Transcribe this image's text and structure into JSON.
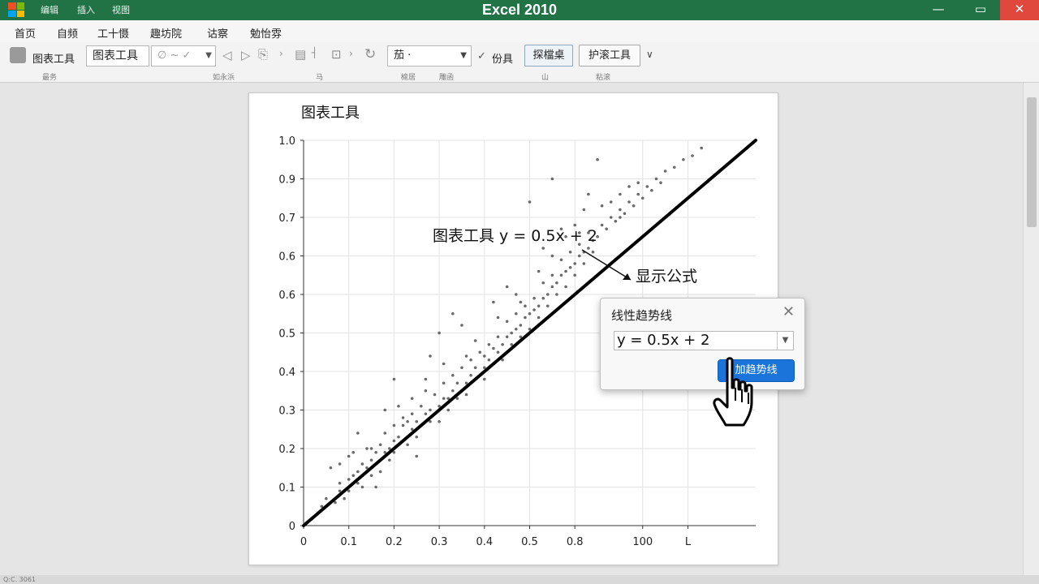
{
  "window": {
    "title": "Excel 2010",
    "minimize": "—",
    "maximize": "▭",
    "close": "✕"
  },
  "colors": {
    "titlebar": "#217346",
    "accent_button": "#1b74d9",
    "trendline": "#000000",
    "points": "#6a6a6a"
  },
  "quick_access": [
    "编辑",
    "插入",
    "视图"
  ],
  "menu": [
    "首页",
    "自频",
    "工十慑",
    "趣坊院",
    "诂察",
    "勉怡雰"
  ],
  "ribbon": {
    "chart_tools_label": "图表工具",
    "chart_tools_box": "图表工具",
    "style_box": "∅ ~ ✓",
    "font_box": "茄 ·",
    "check": "✓",
    "lbl_format": "份具",
    "btn_layout": "探檔桌",
    "btn_protect": "护滚工具",
    "group_labels": [
      "最务",
      "如永浜",
      "马",
      "榆居",
      "雕函",
      "山",
      "粘滚"
    ]
  },
  "status": {
    "left": "Q:C. 3061"
  },
  "chart": {
    "title": "图表工具",
    "annotation": "图表工具  y = 0.5x + 2",
    "callout": "显示公式"
  },
  "dialog": {
    "title": "线性趋势线",
    "close": "✕",
    "select_value": "y = 0.5x + 2",
    "button_label": "加趋势线"
  },
  "chart_data": {
    "type": "scatter",
    "title": "图表工具",
    "xlabel": "",
    "ylabel": "",
    "x_ticks": [
      "0",
      "0.1",
      "0.2",
      "0.3",
      "0.4",
      "0.5",
      "0.8",
      "100",
      "L"
    ],
    "y_ticks": [
      "0",
      "0.1",
      "0.2",
      "0.3",
      "0.4",
      "0.5",
      "0.6",
      "0.6",
      "0.7",
      "0.9",
      "1.0"
    ],
    "y_tick_values": [
      0,
      0.1,
      0.2,
      0.3,
      0.4,
      0.5,
      0.6,
      0.7,
      0.8,
      0.9,
      1.0
    ],
    "xlim": [
      0,
      1.0
    ],
    "ylim": [
      0,
      1.0
    ],
    "grid": true,
    "trendline": {
      "type": "linear",
      "x": [
        0,
        1.0
      ],
      "y": [
        0,
        1.0
      ],
      "equation": "y = 0.5x + 2"
    },
    "series": [
      {
        "points": [
          [
            0.04,
            0.05
          ],
          [
            0.05,
            0.07
          ],
          [
            0.06,
            0.15
          ],
          [
            0.07,
            0.06
          ],
          [
            0.08,
            0.11
          ],
          [
            0.08,
            0.09
          ],
          [
            0.09,
            0.07
          ],
          [
            0.1,
            0.12
          ],
          [
            0.1,
            0.09
          ],
          [
            0.11,
            0.13
          ],
          [
            0.11,
            0.19
          ],
          [
            0.12,
            0.11
          ],
          [
            0.12,
            0.14
          ],
          [
            0.13,
            0.16
          ],
          [
            0.13,
            0.1
          ],
          [
            0.14,
            0.15
          ],
          [
            0.14,
            0.2
          ],
          [
            0.15,
            0.13
          ],
          [
            0.15,
            0.17
          ],
          [
            0.16,
            0.1
          ],
          [
            0.16,
            0.19
          ],
          [
            0.17,
            0.21
          ],
          [
            0.17,
            0.14
          ],
          [
            0.18,
            0.19
          ],
          [
            0.18,
            0.24
          ],
          [
            0.19,
            0.2
          ],
          [
            0.19,
            0.17
          ],
          [
            0.2,
            0.22
          ],
          [
            0.2,
            0.26
          ],
          [
            0.2,
            0.19
          ],
          [
            0.21,
            0.23
          ],
          [
            0.21,
            0.31
          ],
          [
            0.22,
            0.22
          ],
          [
            0.22,
            0.26
          ],
          [
            0.23,
            0.21
          ],
          [
            0.23,
            0.27
          ],
          [
            0.24,
            0.25
          ],
          [
            0.24,
            0.29
          ],
          [
            0.25,
            0.23
          ],
          [
            0.25,
            0.27
          ],
          [
            0.26,
            0.31
          ],
          [
            0.26,
            0.26
          ],
          [
            0.27,
            0.29
          ],
          [
            0.27,
            0.35
          ],
          [
            0.28,
            0.27
          ],
          [
            0.28,
            0.3
          ],
          [
            0.29,
            0.34
          ],
          [
            0.29,
            0.29
          ],
          [
            0.3,
            0.31
          ],
          [
            0.3,
            0.27
          ],
          [
            0.31,
            0.33
          ],
          [
            0.31,
            0.37
          ],
          [
            0.32,
            0.33
          ],
          [
            0.32,
            0.3
          ],
          [
            0.33,
            0.35
          ],
          [
            0.33,
            0.39
          ],
          [
            0.34,
            0.33
          ],
          [
            0.34,
            0.37
          ],
          [
            0.35,
            0.35
          ],
          [
            0.35,
            0.41
          ],
          [
            0.36,
            0.37
          ],
          [
            0.36,
            0.34
          ],
          [
            0.37,
            0.39
          ],
          [
            0.37,
            0.43
          ],
          [
            0.38,
            0.38
          ],
          [
            0.38,
            0.41
          ],
          [
            0.39,
            0.39
          ],
          [
            0.39,
            0.45
          ],
          [
            0.4,
            0.41
          ],
          [
            0.4,
            0.44
          ],
          [
            0.41,
            0.43
          ],
          [
            0.41,
            0.47
          ],
          [
            0.42,
            0.42
          ],
          [
            0.42,
            0.46
          ],
          [
            0.43,
            0.45
          ],
          [
            0.43,
            0.49
          ],
          [
            0.44,
            0.47
          ],
          [
            0.44,
            0.43
          ],
          [
            0.45,
            0.49
          ],
          [
            0.45,
            0.53
          ],
          [
            0.46,
            0.5
          ],
          [
            0.46,
            0.47
          ],
          [
            0.47,
            0.51
          ],
          [
            0.47,
            0.55
          ],
          [
            0.48,
            0.52
          ],
          [
            0.48,
            0.49
          ],
          [
            0.49,
            0.54
          ],
          [
            0.49,
            0.57
          ],
          [
            0.5,
            0.55
          ],
          [
            0.5,
            0.51
          ],
          [
            0.51,
            0.56
          ],
          [
            0.51,
            0.59
          ],
          [
            0.52,
            0.57
          ],
          [
            0.52,
            0.54
          ],
          [
            0.53,
            0.59
          ],
          [
            0.53,
            0.63
          ],
          [
            0.54,
            0.6
          ],
          [
            0.54,
            0.57
          ],
          [
            0.55,
            0.62
          ],
          [
            0.55,
            0.65
          ],
          [
            0.56,
            0.63
          ],
          [
            0.56,
            0.6
          ],
          [
            0.57,
            0.65
          ],
          [
            0.57,
            0.69
          ],
          [
            0.58,
            0.66
          ],
          [
            0.58,
            0.62
          ],
          [
            0.59,
            0.67
          ],
          [
            0.59,
            0.71
          ],
          [
            0.6,
            0.68
          ],
          [
            0.6,
            0.65
          ],
          [
            0.61,
            0.7
          ],
          [
            0.61,
            0.73
          ],
          [
            0.62,
            0.71
          ],
          [
            0.62,
            0.68
          ],
          [
            0.63,
            0.72
          ],
          [
            0.63,
            0.76
          ],
          [
            0.64,
            0.74
          ],
          [
            0.64,
            0.71
          ],
          [
            0.65,
            0.75
          ],
          [
            0.66,
            0.78
          ],
          [
            0.67,
            0.77
          ],
          [
            0.68,
            0.8
          ],
          [
            0.69,
            0.79
          ],
          [
            0.7,
            0.82
          ],
          [
            0.71,
            0.81
          ],
          [
            0.72,
            0.84
          ],
          [
            0.73,
            0.83
          ],
          [
            0.74,
            0.86
          ],
          [
            0.75,
            0.85
          ],
          [
            0.76,
            0.88
          ],
          [
            0.77,
            0.87
          ],
          [
            0.78,
            0.9
          ],
          [
            0.79,
            0.89
          ],
          [
            0.8,
            0.92
          ],
          [
            0.82,
            0.93
          ],
          [
            0.84,
            0.95
          ],
          [
            0.86,
            0.96
          ],
          [
            0.88,
            0.98
          ],
          [
            0.3,
            0.5
          ],
          [
            0.25,
            0.18
          ],
          [
            0.35,
            0.52
          ],
          [
            0.4,
            0.38
          ],
          [
            0.5,
            0.84
          ],
          [
            0.55,
            0.9
          ],
          [
            0.45,
            0.62
          ],
          [
            0.2,
            0.38
          ],
          [
            0.15,
            0.2
          ],
          [
            0.6,
            0.78
          ],
          [
            0.65,
            0.95
          ],
          [
            0.7,
            0.8
          ],
          [
            0.38,
            0.48
          ],
          [
            0.28,
            0.44
          ],
          [
            0.33,
            0.55
          ],
          [
            0.42,
            0.58
          ],
          [
            0.52,
            0.66
          ],
          [
            0.58,
            0.75
          ],
          [
            0.62,
            0.82
          ],
          [
            0.22,
            0.28
          ],
          [
            0.18,
            0.3
          ],
          [
            0.12,
            0.24
          ],
          [
            0.1,
            0.18
          ],
          [
            0.08,
            0.16
          ],
          [
            0.47,
            0.6
          ],
          [
            0.53,
            0.72
          ],
          [
            0.57,
            0.77
          ],
          [
            0.63,
            0.86
          ],
          [
            0.68,
            0.84
          ],
          [
            0.72,
            0.88
          ],
          [
            0.36,
            0.44
          ],
          [
            0.31,
            0.42
          ],
          [
            0.27,
            0.38
          ],
          [
            0.24,
            0.33
          ],
          [
            0.43,
            0.54
          ],
          [
            0.48,
            0.58
          ],
          [
            0.55,
            0.7
          ],
          [
            0.61,
            0.76
          ],
          [
            0.66,
            0.83
          ],
          [
            0.7,
            0.86
          ],
          [
            0.74,
            0.89
          ]
        ]
      }
    ]
  }
}
